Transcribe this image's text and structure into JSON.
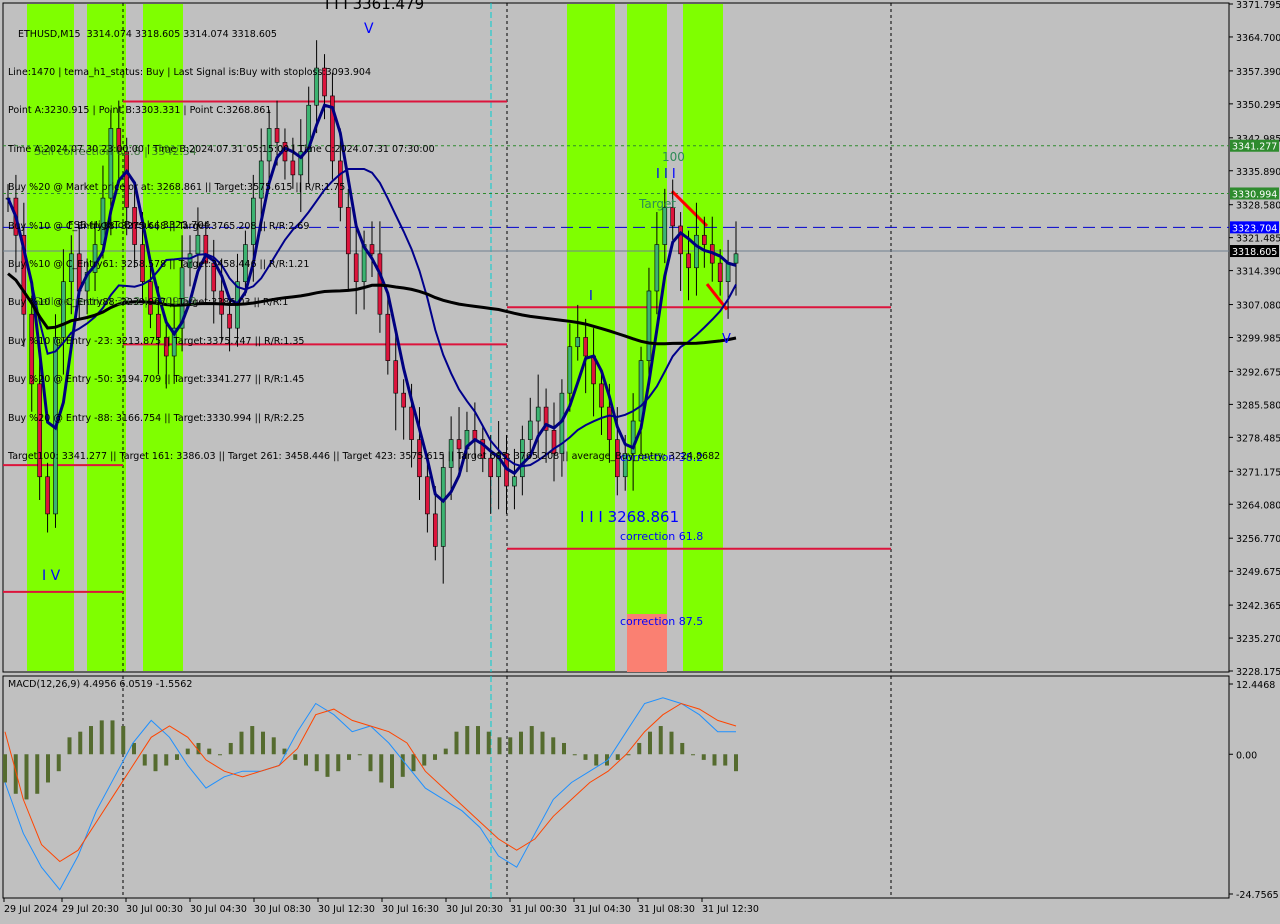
{
  "chart_data": {
    "type": "candlestick",
    "symbol": "ETHUSD",
    "timeframe": "M15",
    "ohlc_header": {
      "open": 3314.074,
      "high": 3318.605,
      "low": 3314.074,
      "close": 3318.605
    },
    "title": "ETHUSD,M15  3314.074 3318.605 3314.074 3318.605",
    "info_lines": [
      "Line:1470 | tema_h1_status: Buy | Last Signal is:Buy with stoploss:3093.904",
      "Point A:3230.915 | Point B:3303.331 | Point C:3268.861",
      "Time A:2024.07.30 23:00:00 | Time B:2024.07.31 05:15:00 | Time C:2024.07.31 07:30:00",
      "Buy %20 @ Market price or at: 3268.861 || Target:3575.615 || R/R:1.75",
      "Buy %10 @ C_Entry38: 3275.668 || Target:3765.208 || R/R:2.69",
      "Buy %10 @ C_Entry61: 3258.578 || Target:3458.446 || R/R:1.21",
      "Buy %10 @ C_Entry88: 3239.967 || Target:3386.03 || R/R:1",
      "Buy %10 @ Entry -23: 3213.875 || Target:3375.747 || R/R:1.35",
      "Buy %20 @ Entry -50: 3194.709 || Target:3341.277 || R/R:1.45",
      "Buy %20 @ Entry -88: 3166.754 || Target:3330.994 || R/R:2.25",
      "Target100: 3341.277 || Target 161: 3386.03 || Target 261: 3458.446 || Target 423: 3575.615 || Target 685: 3765.208 || average_Buy_entry: 3224.8682"
    ],
    "price_axis": {
      "ylim": [
        3228.175,
        3371.795
      ],
      "ticks": [
        3371.795,
        3364.7,
        3357.39,
        3350.295,
        3342.985,
        3335.89,
        3328.58,
        3321.485,
        3314.39,
        3307.08,
        3299.985,
        3292.675,
        3285.58,
        3278.485,
        3271.175,
        3264.08,
        3256.77,
        3249.675,
        3242.365,
        3235.27,
        3228.175
      ]
    },
    "price_labels": [
      {
        "value": 3341.277,
        "text": "3341.277",
        "color": "#2e8b2e"
      },
      {
        "value": 3330.994,
        "text": "3330.994",
        "color": "#2e8b2e"
      },
      {
        "value": 3323.704,
        "text": "3323.704",
        "color": "#0000ff"
      },
      {
        "value": 3318.605,
        "text": "3318.605",
        "color": "#000000"
      }
    ],
    "time_axis": {
      "ticks": [
        "29 Jul 2024",
        "29 Jul 20:30",
        "30 Jul 00:30",
        "30 Jul 04:30",
        "30 Jul 08:30",
        "30 Jul 12:30",
        "30 Jul 16:30",
        "30 Jul 20:30",
        "31 Jul 00:30",
        "31 Jul 04:30",
        "31 Jul 08:30",
        "31 Jul 12:30"
      ]
    },
    "annotations": {
      "top_label": "I I I 3361.479",
      "fsb": "FSB-HighToBreak | 3323.704",
      "sell_corr_382": "Sell correction 38.2 | 3309.59",
      "sell_corr_618": "Sell correction 61.8 | 3342.34",
      "wave_iv": "I V",
      "wave_v": "V",
      "wave_i": "I",
      "wave_iii": "I I I",
      "wave_v2": "V",
      "target_100": "100",
      "target_text": "Target",
      "point_c": "I I I 3268.861",
      "corr_382": "correction 38.2",
      "corr_618": "correction 61.8",
      "corr_875": "correction 87.5"
    },
    "levels": {
      "target100": 3341.277,
      "target_b": 3330.994,
      "fsb_high": 3323.704,
      "current": 3318.605,
      "red_1": 3350.8,
      "red_2": 3306.5,
      "red_3": 3298.5,
      "red_4": 3272.5,
      "red_5": 3254.5,
      "red_6": 3245.2
    },
    "close_series": [
      3330,
      3322,
      3305,
      3290,
      3270,
      3262,
      3300,
      3312,
      3318,
      3310,
      3314,
      3320,
      3330,
      3345,
      3340,
      3328,
      3320,
      3312,
      3305,
      3300,
      3296,
      3302,
      3315,
      3318,
      3322,
      3316,
      3310,
      3305,
      3302,
      3312,
      3320,
      3330,
      3338,
      3345,
      3342,
      3338,
      3335,
      3340,
      3350,
      3358,
      3352,
      3338,
      3328,
      3318,
      3312,
      3320,
      3318,
      3305,
      3295,
      3288,
      3285,
      3278,
      3270,
      3262,
      3255,
      3272,
      3278,
      3276,
      3280,
      3278,
      3274,
      3270,
      3275,
      3268,
      3270,
      3278,
      3282,
      3285,
      3280,
      3275,
      3288,
      3298,
      3300,
      3296,
      3290,
      3285,
      3278,
      3270,
      3275,
      3282,
      3295,
      3310,
      3320,
      3328,
      3324,
      3318,
      3315,
      3322,
      3320,
      3316,
      3312,
      3316,
      3318
    ],
    "macd": {
      "label": "MACD(12,26,9) 4.4956 6.0519 -1.5562",
      "params": "12,26,9",
      "histogram_value": 4.4956,
      "signal_value": 6.0519,
      "diff_value": -1.5562,
      "ylim": [
        -24.7565,
        12.4468
      ],
      "ticks": [
        12.4468,
        0.0,
        -24.7565
      ],
      "macd_series": [
        -5,
        -14,
        -20,
        -24,
        -18,
        -10,
        -4,
        2,
        6,
        3,
        -2,
        -6,
        -4,
        -3,
        -3,
        -2,
        4,
        9,
        7,
        4,
        5,
        2,
        -2,
        -6,
        -8,
        -10,
        -13,
        -18,
        -20,
        -14,
        -8,
        -5,
        -3,
        -1,
        4,
        9,
        10,
        9,
        7,
        4,
        4
      ],
      "signal_series": [
        4,
        -8,
        -16,
        -19,
        -17,
        -12,
        -7,
        -2,
        3,
        5,
        3,
        -1,
        -3,
        -4,
        -3,
        -2,
        1,
        7,
        8,
        6,
        5,
        4,
        2,
        -3,
        -6,
        -9,
        -12,
        -15,
        -17,
        -15,
        -11,
        -8,
        -5,
        -3,
        0,
        4,
        7,
        9,
        8,
        6,
        5
      ],
      "histogram_series": [
        -5,
        -7,
        -8,
        -7,
        -5,
        -3,
        3,
        4,
        5,
        6,
        6,
        5,
        2,
        -2,
        -3,
        -2,
        -1,
        1,
        2,
        1,
        0,
        2,
        4,
        5,
        4,
        3,
        1,
        -1,
        -2,
        -3,
        -4,
        -3,
        -1,
        0,
        -3,
        -5,
        -6,
        -4,
        -3,
        -2,
        -1,
        1,
        4,
        5,
        5,
        4,
        3,
        3,
        4,
        5,
        4,
        3,
        2,
        0,
        -1,
        -2,
        -2,
        -1,
        0,
        2,
        4,
        5,
        4,
        2,
        0,
        -1,
        -2,
        -2,
        -3
      ]
    }
  }
}
